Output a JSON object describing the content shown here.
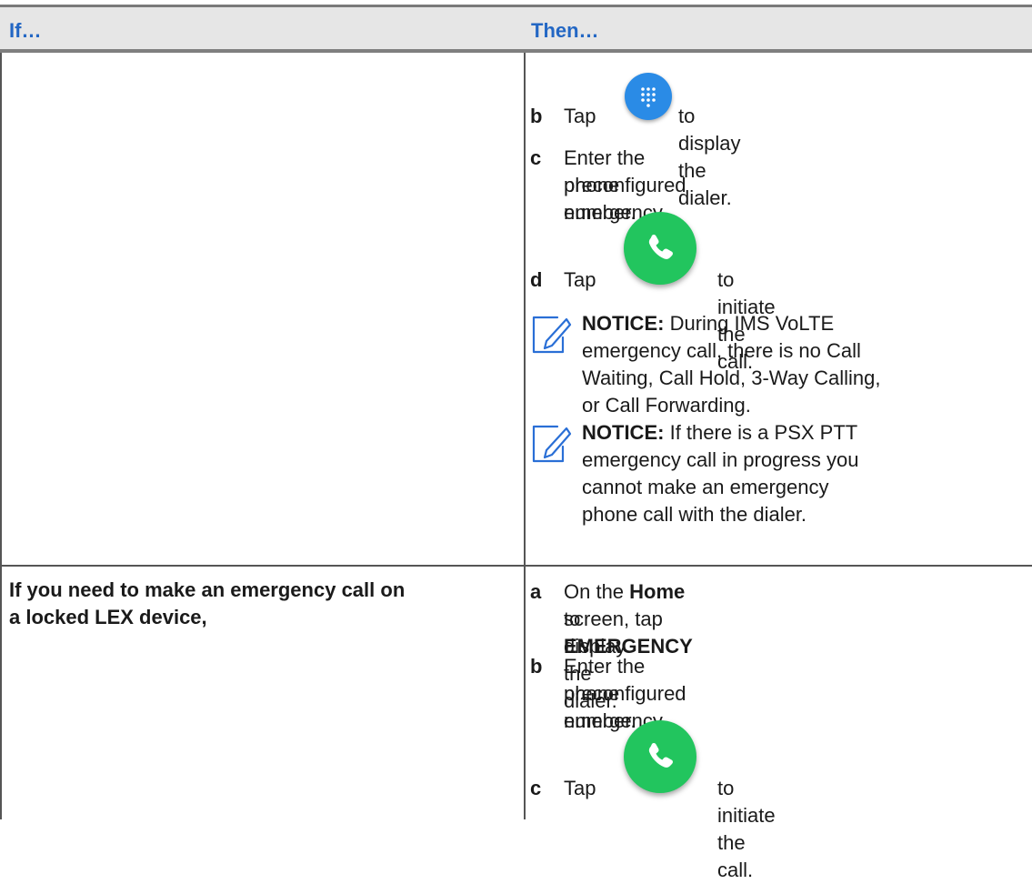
{
  "header": {
    "if_label": "If…",
    "then_label": "Then…"
  },
  "row1": {
    "steps": {
      "b": {
        "letter": "b",
        "before": "Tap",
        "after": "to display the dialer."
      },
      "c": {
        "letter": "c",
        "line1": "Enter the preconfigured emergency",
        "line2": "phone number."
      },
      "d": {
        "letter": "d",
        "before": "Tap",
        "after": "to initiate the call."
      }
    },
    "notices": [
      {
        "label": "NOTICE:",
        "lines": [
          "During IMS VoLTE",
          "emergency call, there is no Call",
          "Waiting, Call Hold, 3-Way Calling,",
          "or Call Forwarding."
        ]
      },
      {
        "label": "NOTICE:",
        "lines": [
          "If there is a PSX PTT",
          "emergency call in progress you",
          "cannot make an emergency",
          "phone call with the dialer."
        ]
      }
    ]
  },
  "row2": {
    "condition": {
      "line1": "If you need to make an emergency call on",
      "line2": "a locked LEX device,"
    },
    "steps": {
      "a": {
        "letter": "a",
        "p1": "On the ",
        "home": "Home",
        "p2": " screen, tap ",
        "emergency": "EMERGENCY",
        "line2": "to display the dialer."
      },
      "b": {
        "letter": "b",
        "line1": "Enter the preconfigured emergency",
        "line2": "phone number."
      },
      "c": {
        "letter": "c",
        "before": "Tap",
        "after": "to initiate the call."
      }
    }
  },
  "icons": {
    "dialpad": "dialpad-icon",
    "phone": "phone-icon",
    "notice": "notice-pencil-icon"
  },
  "colors": {
    "header_text": "#2367c4",
    "dial_button": "#2a8be6",
    "call_button": "#22c55e",
    "notice_icon": "#2a6fd6"
  }
}
